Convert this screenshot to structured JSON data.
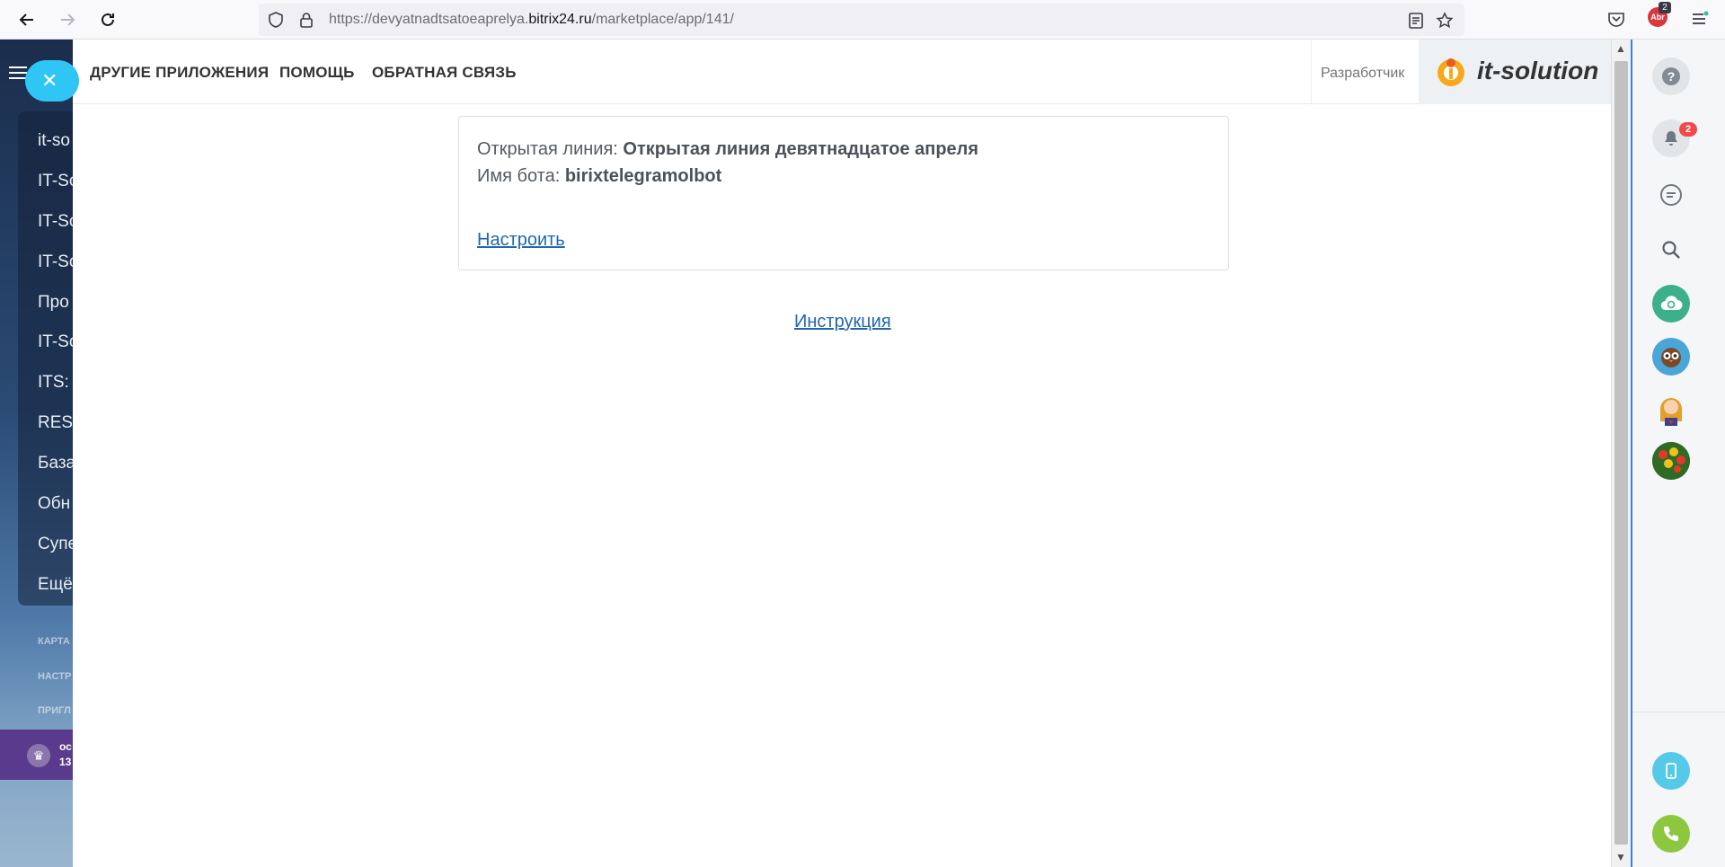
{
  "browser": {
    "url_prefix": "https://devyatnadtsatoeaprelya.",
    "url_host": "bitrix24.ru",
    "url_path": "/marketplace/app/141/",
    "extension_badge": "Abr",
    "extension_count": "2"
  },
  "left_menu": {
    "items": [
      "it-so",
      "IT-Sc",
      "IT-Sc",
      "IT-Sc",
      "Про",
      "IT-Sc",
      "ITS: T",
      "REST",
      "База",
      "Обн",
      "Супе",
      "Ещё"
    ],
    "small_items": [
      "КАРТА",
      "НАСТР",
      "ПРИГЛ"
    ],
    "promo_lines": [
      "ос",
      "13"
    ]
  },
  "app_nav": {
    "links": [
      "ДРУГИЕ ПРИЛОЖЕНИЯ",
      "ПОМОЩЬ",
      "ОБРАТНАЯ СВЯЗЬ"
    ],
    "developer_label": "Разработчик",
    "logo_text": "it-solution"
  },
  "card": {
    "line_label": "Открытая линия:",
    "line_value": "Открытая линия девятнадцатое апреля",
    "bot_label": "Имя бота:",
    "bot_value": "birixtelegramolbot",
    "configure_link": "Настроить"
  },
  "instruction_link": "Инструкция",
  "right_bar": {
    "notifications_count": "2"
  },
  "colors": {
    "accent": "#2fc6f6",
    "link": "#2067b0",
    "badge": "#f04a4a"
  }
}
